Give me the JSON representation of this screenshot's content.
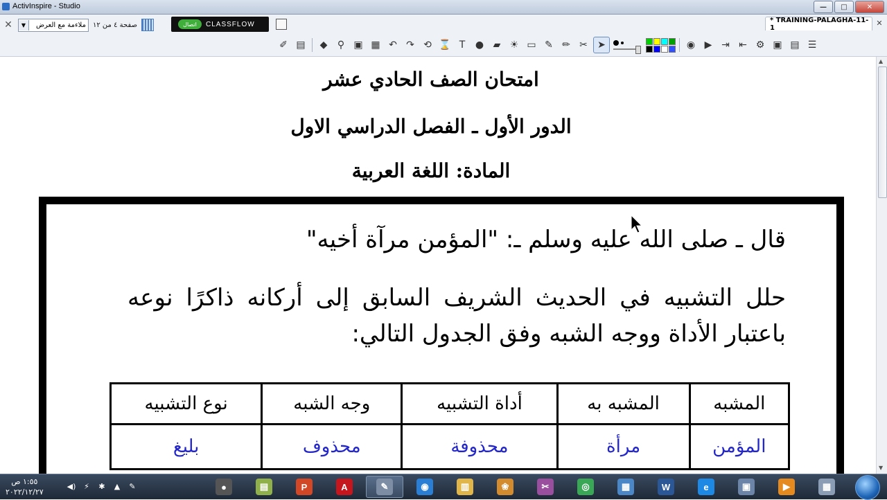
{
  "window": {
    "title": "ActivInspire - Studio",
    "controls": [
      "—",
      "□",
      "✕"
    ]
  },
  "toolbar": {
    "view_mode": "ملاءمة مع العرض",
    "page_indicator": "صفحة ٤ من ١٢",
    "classflow": {
      "label": "CLASSFLOW",
      "connect": "اتصال"
    },
    "doc_tab": "* TRAINING-PALAGHA-11-1",
    "colors": [
      "#00d000",
      "#ffff00",
      "#00ffff",
      "#00a000",
      "#000000",
      "#0000ff",
      "#ffffff",
      "#3050ff"
    ]
  },
  "page": {
    "heading1": "امتحان الصف الحادي عشر",
    "heading2": "الدور الأول ـ الفصل الدراسي الاول",
    "heading3": "المادة: اللغة العربية",
    "line1": "قال ـ صلى الله عليه وسلم ـ: \"المؤمن مرآة أخيه\"",
    "line2": "حلل التشبيه في الحديث الشريف السابق إلى أركانه ذاكرًا نوعه باعتبار الأداة ووجه الشبه وفق الجدول التالي:",
    "table": {
      "headers": [
        "المشبه",
        "المشبه به",
        "أداة التشبيه",
        "وجه الشبه",
        "نوع التشبيه"
      ],
      "row": [
        "المؤمن",
        "مرأة",
        "محذوفة",
        "محذوف",
        "بليغ"
      ]
    }
  },
  "taskbar": {
    "time": "١:٥٥ ص",
    "date": "٢٠٢٢/١٢/٢٧",
    "apps": [
      {
        "name": "camera",
        "glyph": "●",
        "color": "#555555"
      },
      {
        "name": "activinspire",
        "glyph": "▤",
        "color": "#8fb04a"
      },
      {
        "name": "powerpoint",
        "glyph": "P",
        "color": "#d24726"
      },
      {
        "name": "acrobat",
        "glyph": "A",
        "color": "#c4161c"
      },
      {
        "name": "studio",
        "glyph": "✎",
        "color": "#7d8da3"
      },
      {
        "name": "media",
        "glyph": "◉",
        "color": "#2a7fd4"
      },
      {
        "name": "explorer",
        "glyph": "▥",
        "color": "#e0b54a"
      },
      {
        "name": "paint",
        "glyph": "❀",
        "color": "#d38b2f"
      },
      {
        "name": "tools",
        "glyph": "✂",
        "color": "#9a4f9e"
      },
      {
        "name": "chrome",
        "glyph": "◎",
        "color": "#3aa757"
      },
      {
        "name": "control",
        "glyph": "▦",
        "color": "#4b86c7"
      },
      {
        "name": "word",
        "glyph": "W",
        "color": "#2b5797"
      },
      {
        "name": "ie",
        "glyph": "e",
        "color": "#1e88e5"
      },
      {
        "name": "network",
        "glyph": "▣",
        "color": "#6c84a8"
      },
      {
        "name": "player",
        "glyph": "▶",
        "color": "#e58a1f"
      },
      {
        "name": "calculator",
        "glyph": "▦",
        "color": "#8b9cb5"
      }
    ]
  }
}
